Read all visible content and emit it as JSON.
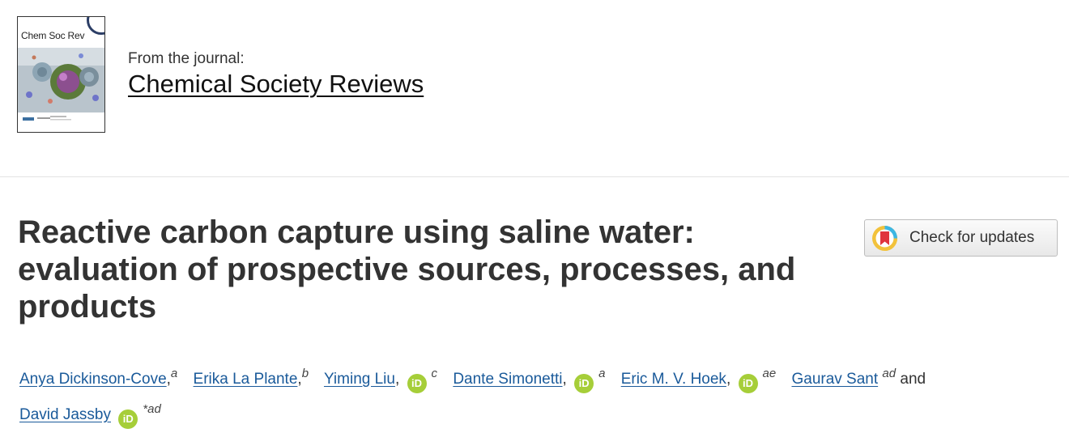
{
  "journal": {
    "cover_title": "Chem Soc Rev",
    "from_label": "From the journal:",
    "name": "Chemical Society Reviews"
  },
  "article": {
    "title": "Reactive carbon capture using saline water: evaluation of prospective sources, processes, and products"
  },
  "check_updates": {
    "label": "Check for updates"
  },
  "authors": [
    {
      "name": "Anya Dickinson-Cove",
      "affil": "a",
      "orcid": false,
      "corresponding": false
    },
    {
      "name": "Erika La Plante",
      "affil": "b",
      "orcid": false,
      "corresponding": false
    },
    {
      "name": "Yiming Liu",
      "affil": "c",
      "orcid": true,
      "corresponding": false
    },
    {
      "name": "Dante Simonetti",
      "affil": "a",
      "orcid": true,
      "corresponding": false
    },
    {
      "name": "Eric M. V. Hoek",
      "affil": "ae",
      "orcid": true,
      "corresponding": false
    },
    {
      "name": "Gaurav Sant",
      "affil": "ad",
      "orcid": false,
      "corresponding": false
    },
    {
      "name": "David Jassby",
      "affil": "*ad",
      "orcid": true,
      "corresponding": true
    }
  ],
  "authors_conjunction": "and",
  "orcid_icon_text": "iD",
  "colors": {
    "link": "#1a5a9a",
    "orcid": "#a6ce39",
    "title": "#333333"
  }
}
